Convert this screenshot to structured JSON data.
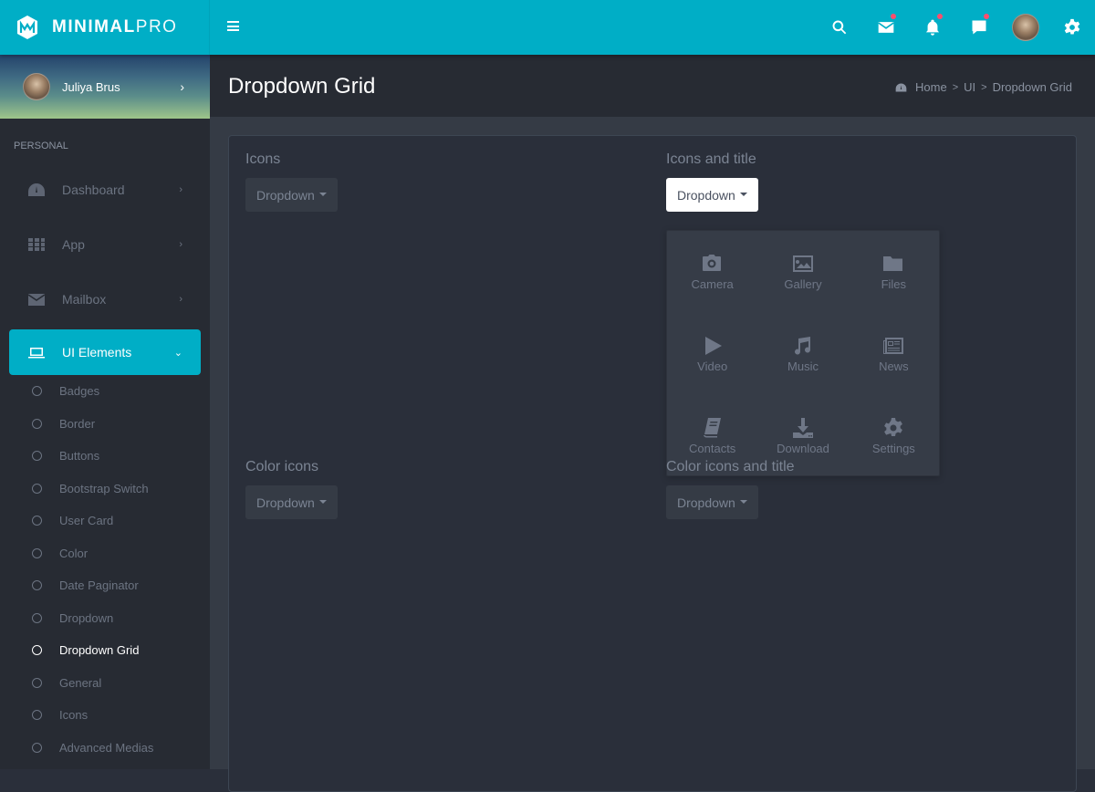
{
  "app": {
    "logo_bold": "MINIMAL",
    "logo_light": "PRO"
  },
  "topbar": {
    "icons": [
      {
        "name": "search-icon",
        "badge": false
      },
      {
        "name": "mail-icon",
        "badge": true
      },
      {
        "name": "bell-icon",
        "badge": true
      },
      {
        "name": "chat-icon",
        "badge": true
      },
      {
        "name": "user-avatar",
        "badge": false
      },
      {
        "name": "gear-icon",
        "badge": false
      }
    ],
    "badge_color": "#ff4d6d",
    "accent_color": "#00aec6"
  },
  "sidebar": {
    "user": {
      "name": "Juliya Brus",
      "chevron": "›"
    },
    "section_label": "PERSONAL",
    "items": [
      {
        "label": "Dashboard",
        "icon": "dashboard-icon",
        "chevron": "›"
      },
      {
        "label": "App",
        "icon": "grid-icon",
        "chevron": "›"
      },
      {
        "label": "Mailbox",
        "icon": "mail-icon",
        "chevron": "›"
      }
    ],
    "active_item": {
      "label": "UI Elements",
      "icon": "laptop-icon",
      "chevron": "⌄"
    },
    "sub_items": [
      {
        "label": "Badges",
        "active": false
      },
      {
        "label": "Border",
        "active": false
      },
      {
        "label": "Buttons",
        "active": false
      },
      {
        "label": "Bootstrap Switch",
        "active": false
      },
      {
        "label": "User Card",
        "active": false
      },
      {
        "label": "Color",
        "active": false
      },
      {
        "label": "Date Paginator",
        "active": false
      },
      {
        "label": "Dropdown",
        "active": false
      },
      {
        "label": "Dropdown Grid",
        "active": true
      },
      {
        "label": "General",
        "active": false
      },
      {
        "label": "Icons",
        "active": false
      },
      {
        "label": "Advanced Medias",
        "active": false
      }
    ]
  },
  "header": {
    "title": "Dropdown Grid",
    "breadcrumb": [
      "Home",
      "UI",
      "Dropdown Grid"
    ],
    "breadcrumb_sep": ">"
  },
  "demos": [
    {
      "title": "Icons",
      "button": "Dropdown",
      "open": false
    },
    {
      "title": "Icons and title",
      "button": "Dropdown",
      "open": true
    },
    {
      "title": "Color icons",
      "button": "Dropdown",
      "open": false
    },
    {
      "title": "Color icons and title",
      "button": "Dropdown",
      "open": false
    }
  ],
  "dropdown_grid": [
    {
      "label": "Camera",
      "icon": "camera-icon"
    },
    {
      "label": "Gallery",
      "icon": "image-icon"
    },
    {
      "label": "Files",
      "icon": "folder-icon"
    },
    {
      "label": "Video",
      "icon": "play-icon"
    },
    {
      "label": "Music",
      "icon": "music-icon"
    },
    {
      "label": "News",
      "icon": "newspaper-icon"
    },
    {
      "label": "Contacts",
      "icon": "book-icon"
    },
    {
      "label": "Download",
      "icon": "download-icon"
    },
    {
      "label": "Settings",
      "icon": "gear-icon"
    }
  ]
}
